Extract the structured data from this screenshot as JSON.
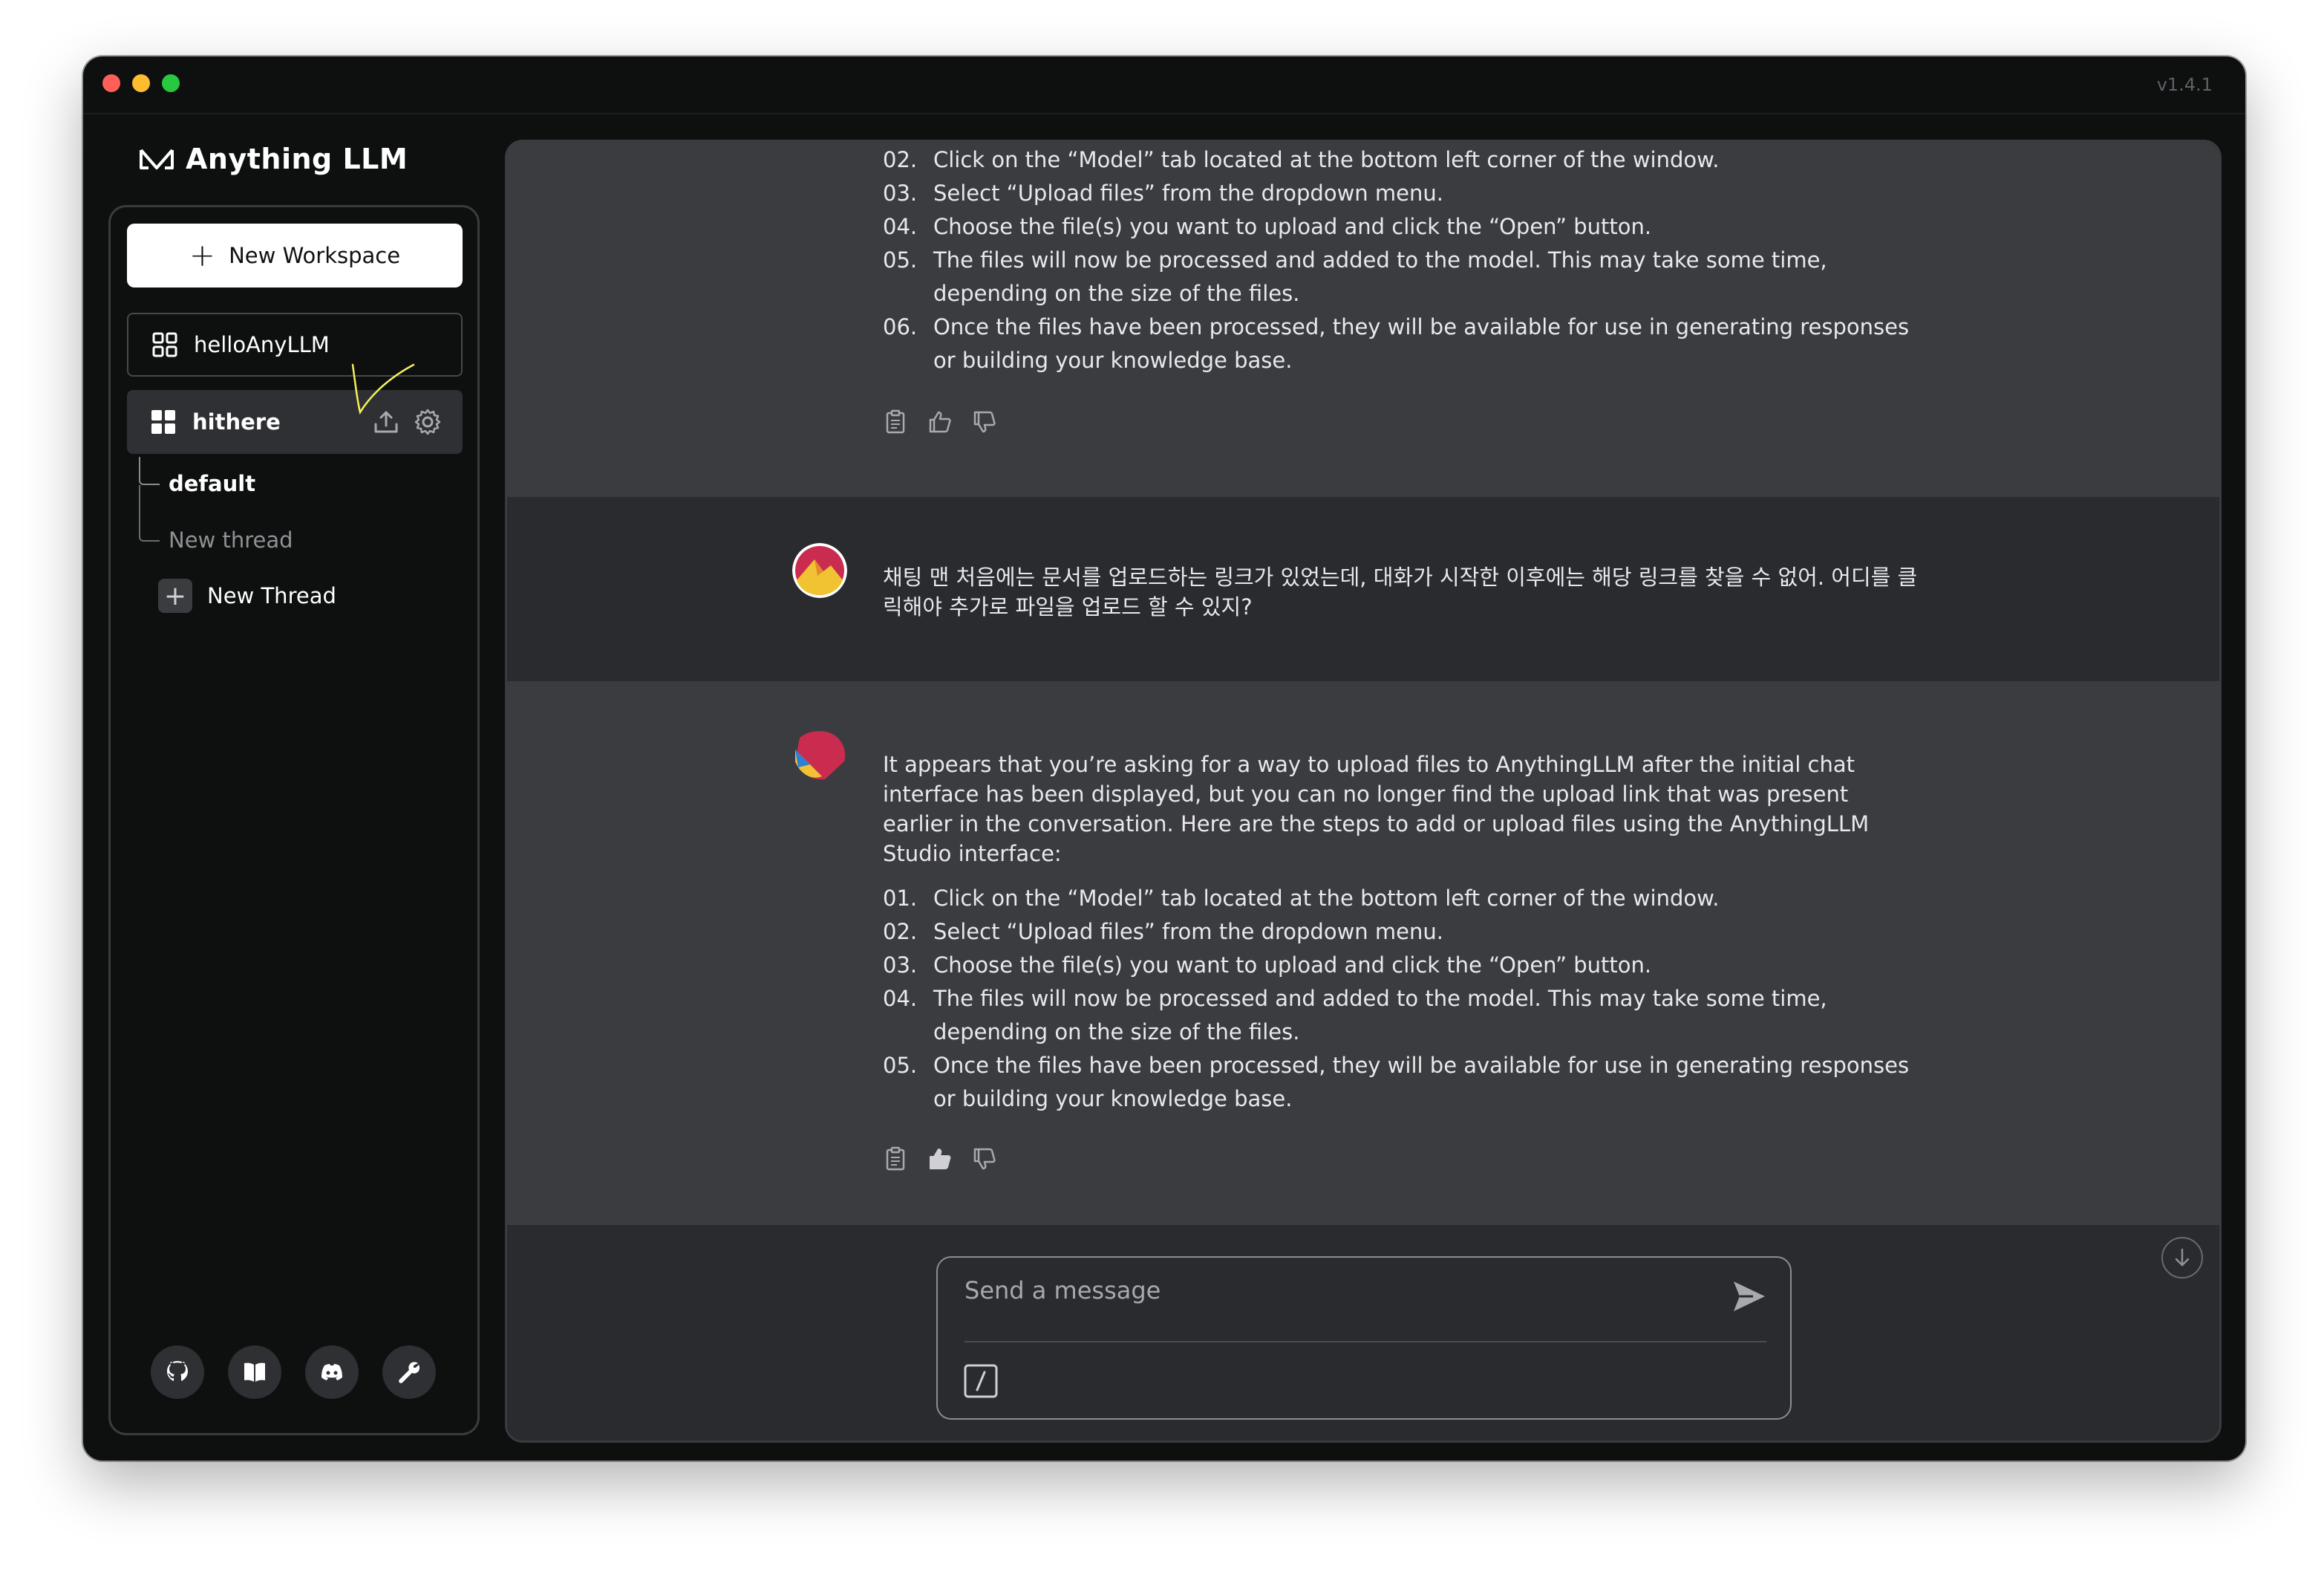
{
  "app": {
    "version": "v1.4.1",
    "brand_name": "Anything LLM"
  },
  "sidebar": {
    "new_workspace_label": "New Workspace",
    "workspaces": [
      {
        "label": "helloAnyLLM"
      },
      {
        "label": "hithere"
      }
    ],
    "threads": [
      {
        "label": "default"
      },
      {
        "label": "New thread"
      }
    ],
    "new_thread_label": "New Thread",
    "footer_icons": [
      "github-icon",
      "book-icon",
      "discord-icon",
      "wrench-icon"
    ]
  },
  "chat": {
    "previous_steps": [
      {
        "num": "02.",
        "text": "Click on the “Model” tab located at the bottom left corner of the window."
      },
      {
        "num": "03.",
        "text": "Select “Upload files” from the dropdown menu."
      },
      {
        "num": "04.",
        "text": "Choose the file(s) you want to upload and click the “Open” button."
      },
      {
        "num": "05.",
        "text": "The files will now be processed and added to the model. This may take some time, depending on the size of the files."
      },
      {
        "num": "06.",
        "text": "Once the files have been processed, they will be available for use in generating responses or building your knowledge base."
      }
    ],
    "user_message": "채팅 맨 처음에는 문서를 업로드하는 링크가 있었는데, 대화가 시작한 이후에는 해당 링크를 찾을 수 없어. 어디를 클릭해야 추가로 파일을 업로드 할 수 있지?",
    "assistant_intro": "It appears that you’re asking for a way to upload files to AnythingLLM after the initial chat interface has been displayed, but you can no longer find the upload link that was present earlier in the conversation. Here are the steps to add or upload files using the AnythingLLM Studio interface:",
    "assistant_steps": [
      {
        "num": "01.",
        "text": "Click on the “Model” tab located at the bottom left corner of the window."
      },
      {
        "num": "02.",
        "text": "Select “Upload files” from the dropdown menu."
      },
      {
        "num": "03.",
        "text": "Choose the file(s) you want to upload and click the “Open” button."
      },
      {
        "num": "04.",
        "text": "The files will now be processed and added to the model. This may take some time, depending on the size of the files."
      },
      {
        "num": "05.",
        "text": "Once the files have been processed, they will be available for use in generating responses or building your knowledge base."
      }
    ]
  },
  "composer": {
    "placeholder": "Send a message"
  },
  "colors": {
    "window_bg": "#0e0f0f",
    "panel_bg": "#2a2b2f",
    "message_bg": "#3b3c40",
    "active_workspace_bg": "#2f3034",
    "annotation": "#f5f05a"
  }
}
